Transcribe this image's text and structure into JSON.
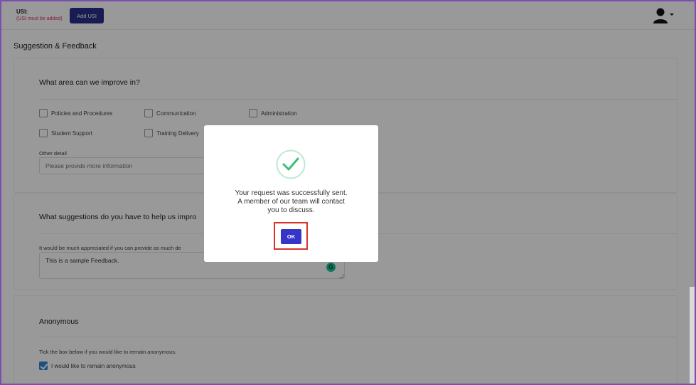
{
  "header": {
    "usi_label": "USI:",
    "usi_warning": "(USI must be added)",
    "add_usi_label": "Add USI",
    "user_icon": "user-icon",
    "dropdown_icon": "caret-down-icon"
  },
  "page": {
    "title": "Suggestion & Feedback"
  },
  "improve_section": {
    "heading": "What area can we improve in?",
    "options": [
      {
        "label": "Policies and Procedures",
        "checked": false
      },
      {
        "label": "Communication",
        "checked": false
      },
      {
        "label": "Administration",
        "checked": false
      },
      {
        "label": "Student Support",
        "checked": false
      },
      {
        "label": "Training Delivery",
        "checked": false
      }
    ],
    "other_label": "Other detail",
    "other_placeholder": "Please provide more information"
  },
  "suggestion_section": {
    "heading": "What suggestions do you have to help us impro",
    "helper": "It would be much appreciated if you can provide as much de",
    "textarea_value": "This is a sample Feedback."
  },
  "anonymous_section": {
    "heading": "Anonymous",
    "helper": "Tick the box below if you would like to remain anonymous.",
    "checkbox_label": "I would like to remain anonymous",
    "checked": true
  },
  "modal": {
    "icon": "success-check-icon",
    "line1": "Your request was successfully sent.",
    "line2": "A member of our team will contact",
    "line3": "you to discuss.",
    "ok_label": "OK"
  },
  "colors": {
    "primary_button": "#2b2f8a",
    "ok_button": "#3535c9",
    "success_green": "#3cbf7c",
    "highlight_red": "#d9322b",
    "warning_text": "#d6336c"
  }
}
